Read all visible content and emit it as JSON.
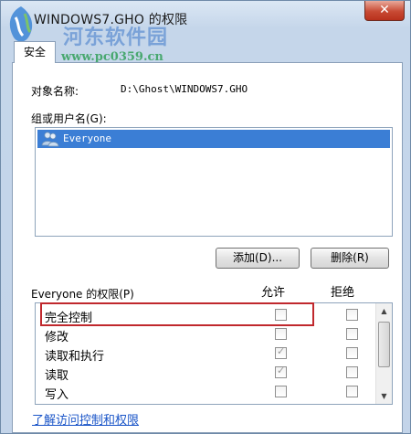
{
  "window": {
    "title": "WINDOWS7.GHO 的权限",
    "close_label": "✕"
  },
  "watermark": {
    "site_name": "河东软件园",
    "url": "www.pc0359.cn"
  },
  "tabs": [
    {
      "label": "安全"
    }
  ],
  "object": {
    "label": "对象名称:",
    "value": "D:\\Ghost\\WINDOWS7.GHO"
  },
  "groups": {
    "label": "组或用户名(G):",
    "items": [
      {
        "name": "Everyone",
        "selected": true
      }
    ]
  },
  "buttons": {
    "add": "添加(D)...",
    "remove": "删除(R)"
  },
  "permissions": {
    "label": "Everyone 的权限(P)",
    "allow_header": "允许",
    "deny_header": "拒绝",
    "rows": [
      {
        "name": "完全控制",
        "allow": false,
        "deny": false
      },
      {
        "name": "修改",
        "allow": false,
        "deny": false
      },
      {
        "name": "读取和执行",
        "allow": true,
        "deny": false
      },
      {
        "name": "读取",
        "allow": true,
        "deny": false
      },
      {
        "name": "写入",
        "allow": false,
        "deny": false
      }
    ]
  },
  "link": {
    "label": "了解访问控制和权限"
  },
  "colors": {
    "selection": "#3b7ed5",
    "highlight_box": "#c0282d",
    "link": "#1a55c8"
  }
}
